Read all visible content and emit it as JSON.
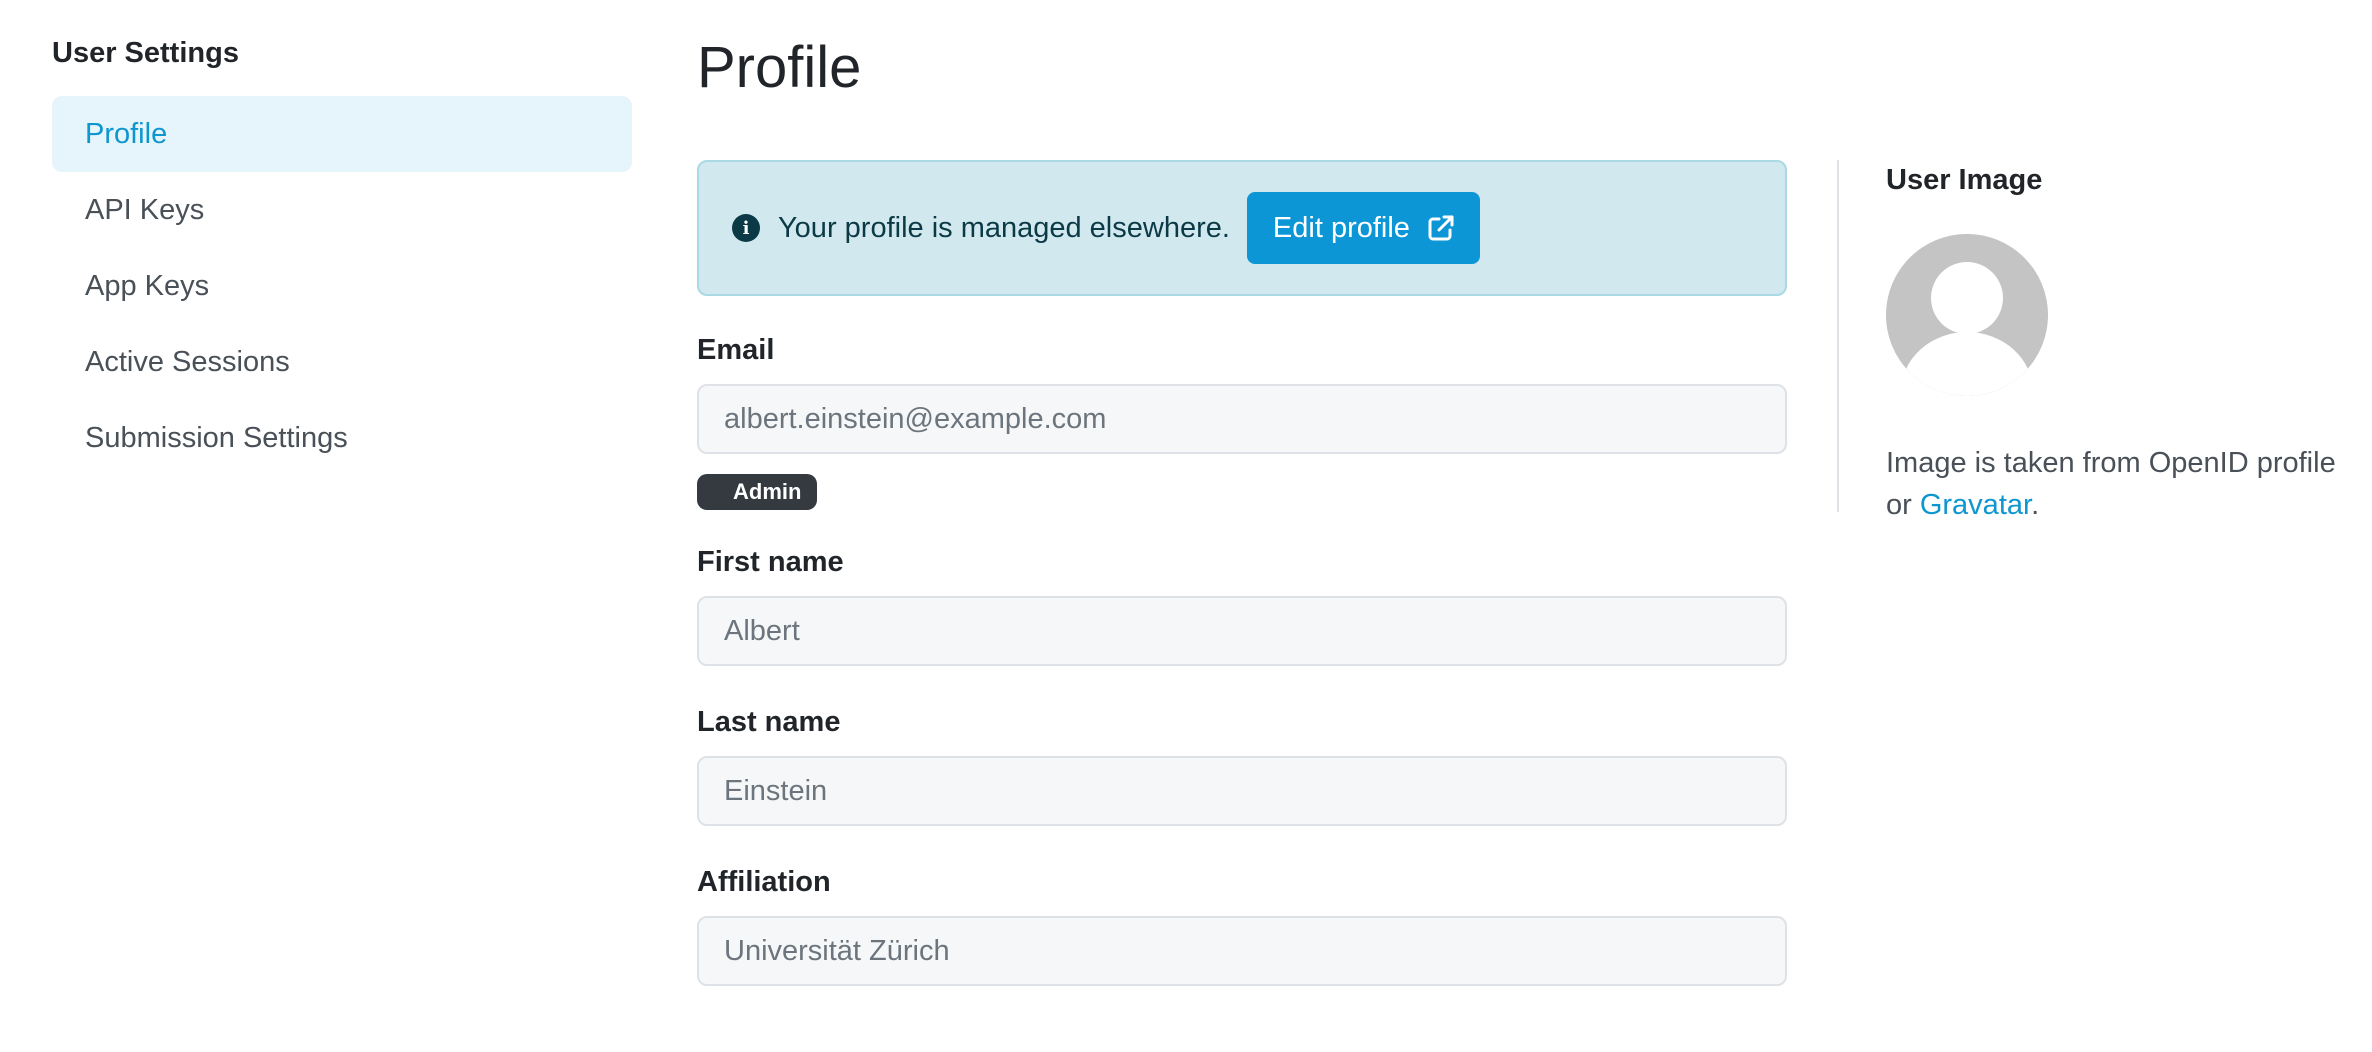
{
  "sidebar": {
    "title": "User Settings",
    "items": [
      {
        "label": "Profile",
        "active": true
      },
      {
        "label": "API Keys",
        "active": false
      },
      {
        "label": "App Keys",
        "active": false
      },
      {
        "label": "Active Sessions",
        "active": false
      },
      {
        "label": "Submission Settings",
        "active": false
      }
    ]
  },
  "main": {
    "title": "Profile",
    "alert": {
      "icon": "info-circle-icon",
      "text": "Your profile is managed elsewhere.",
      "button_label": "Edit profile",
      "button_icon": "external-link-icon"
    },
    "fields": {
      "email": {
        "label": "Email",
        "value": "albert.einstein@example.com"
      },
      "badge": "Admin",
      "first_name": {
        "label": "First name",
        "value": "Albert"
      },
      "last_name": {
        "label": "Last name",
        "value": "Einstein"
      },
      "affiliation": {
        "label": "Affiliation",
        "value": "Universität Zürich"
      }
    }
  },
  "user_image": {
    "title": "User Image",
    "note_prefix": "Image is taken from OpenID profile or ",
    "link_text": "Gravatar",
    "note_suffix": "."
  },
  "colors": {
    "accent": "#0d96d6",
    "active_bg": "#e6f4fb",
    "alert_bg": "#d1e9ee",
    "badge_bg": "#343a40"
  }
}
